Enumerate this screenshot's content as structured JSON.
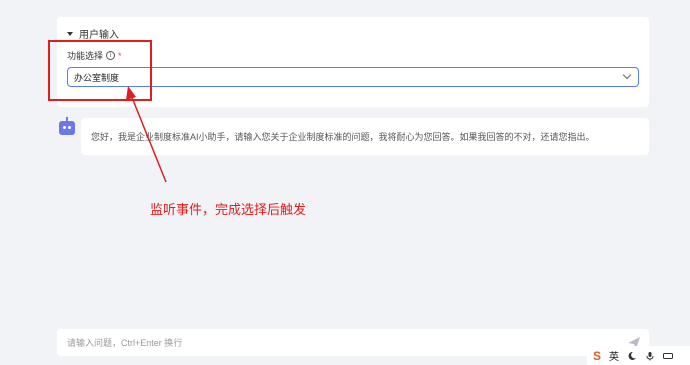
{
  "form": {
    "section_title": "用户输入",
    "field_label": "功能选择",
    "info_glyph": "i",
    "required_mark": "*",
    "select_value": "办公室制度"
  },
  "chat": {
    "bot_message": "您好，我是企业制度标准AI小助手，请输入您关于企业制度标准的问题，我将耐心为您回答。如果我回答的不对，还请您指出。"
  },
  "annotation": {
    "text": "监听事件，完成选择后触发",
    "color": "#e01e1e"
  },
  "input": {
    "placeholder": "请输入问题，Ctrl+Enter 换行"
  },
  "ime": {
    "logo": "S",
    "lang": "英"
  },
  "colors": {
    "accent": "#5b7cf6",
    "bot_avatar": "#6b78e8",
    "annotation": "#e01e1e"
  }
}
